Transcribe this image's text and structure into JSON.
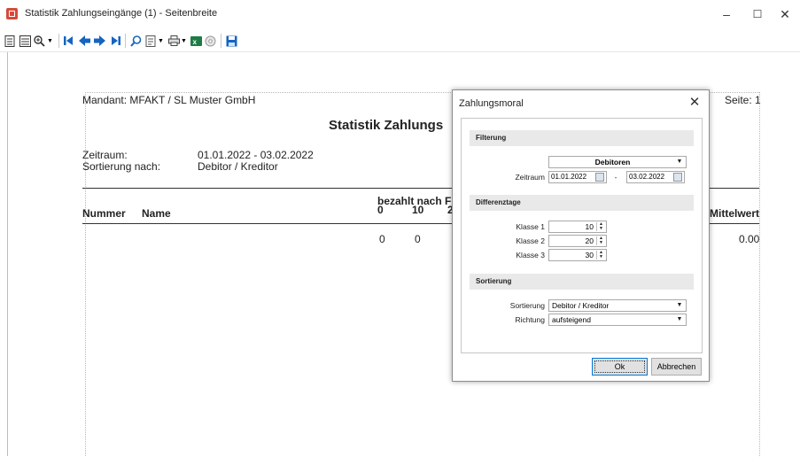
{
  "window": {
    "title": "Statistik Zahlungseingänge (1) - Seitenbreite",
    "minimize": "–",
    "maximize": "☐",
    "close": "✕"
  },
  "report": {
    "mandant": "Mandant: MFAKT / SL Muster GmbH",
    "seite": "Seite: 1",
    "title": "Statistik Zahlungs",
    "zeitraum_label": "Zeitraum:",
    "zeitraum_value": "01.01.2022 - 03.02.2022",
    "sortierung_label": "Sortierung nach:",
    "sortierung_value": "Debitor / Kreditor",
    "col_bezahlt": "bezahlt nach F",
    "col_nummer": "Nummer",
    "col_name": "Name",
    "col_0": "0",
    "col_10": "10",
    "col_2": "2",
    "col_mittelwert": "Mittelwert",
    "row_v0": "0",
    "row_v10": "0",
    "row_mittelwert": "0.00"
  },
  "dialog": {
    "title": "Zahlungsmoral",
    "close": "✕",
    "filterung": {
      "header": "Filterung",
      "type_value": "Debitoren",
      "zeitraum_label": "Zeitraum",
      "date_from": "01.01.2022",
      "date_sep": "-",
      "date_to": "03.02.2022"
    },
    "differenztage": {
      "header": "Differenztage",
      "klassen": [
        {
          "label": "Klasse 1",
          "value": "10"
        },
        {
          "label": "Klasse 2",
          "value": "20"
        },
        {
          "label": "Klasse 3",
          "value": "30"
        }
      ]
    },
    "sortierung": {
      "header": "Sortierung",
      "sortierung_label": "Sortierung",
      "sortierung_value": "Debitor / Kreditor",
      "richtung_label": "Richtung",
      "richtung_value": "aufsteigend"
    },
    "ok": "Ok",
    "abbrechen": "Abbrechen"
  },
  "colors": {
    "accent": "#0078d7",
    "toolbar_blue": "#1565c0",
    "app_icon": "#d64a3a",
    "excel_green": "#1e7b45"
  }
}
